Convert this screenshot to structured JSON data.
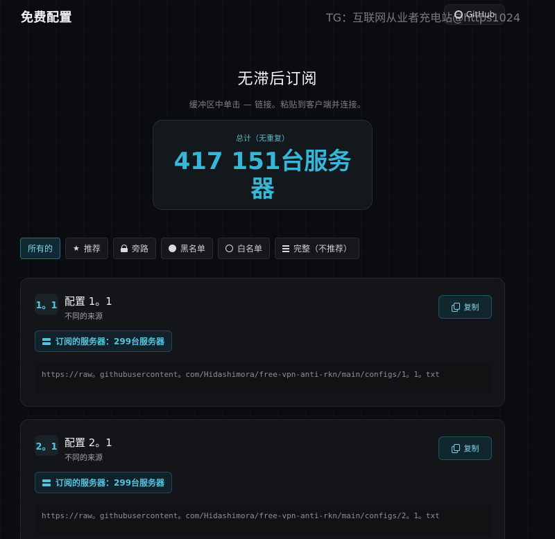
{
  "header": {
    "brand": "免费配置",
    "github_label": "GitHub"
  },
  "watermark": "TG：互联网从业者充电站@https1024",
  "hero": {
    "title": "无滞后订阅",
    "subtitle": "缓冲区中单击 — 链接。粘贴到客户端并连接。",
    "stat_label": "总计（无重复）",
    "stat_value": "417 151台服务器"
  },
  "filters": [
    {
      "label": "所有的",
      "icon": "",
      "active": true
    },
    {
      "label": "推荐",
      "icon": "star-icon",
      "active": false
    },
    {
      "label": "旁路",
      "icon": "lock-open-icon",
      "active": false
    },
    {
      "label": "黑名单",
      "icon": "filled-circle-icon",
      "active": false
    },
    {
      "label": "白名单",
      "icon": "circle-icon",
      "active": false
    },
    {
      "label": "完整（不推荐）",
      "icon": "list-icon",
      "active": false
    }
  ],
  "configs": [
    {
      "index": "1。1",
      "title": "配置 1。1",
      "subtitle": "不同的来源",
      "copy_label": "复制",
      "servers": "订阅的服务器：299台服务器",
      "url": "https://raw。githubusercontent。com/Hidashimora/free-vpn-anti-rkn/main/configs/1。1。txt"
    },
    {
      "index": "2。1",
      "title": "配置 2。1",
      "subtitle": "不同的来源",
      "copy_label": "复制",
      "servers": "订阅的服务器：299台服务器",
      "url": "https://raw。githubusercontent。com/Hidashimora/free-vpn-anti-rkn/main/configs/2。1。txt"
    }
  ],
  "colors": {
    "accent": "#38b6d6",
    "background": "#0b0c0f",
    "card": "#141518"
  }
}
